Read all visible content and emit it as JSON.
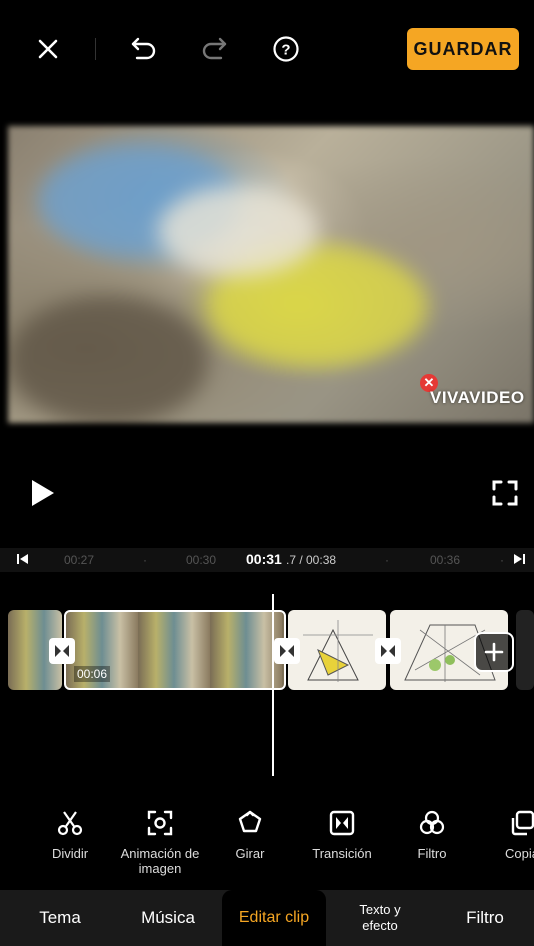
{
  "toolbar": {
    "save_label": "GUARDAR"
  },
  "preview": {
    "watermark_x": "✕",
    "watermark": "VIVAVIDEO"
  },
  "ruler": {
    "t1": "00:27",
    "t2": "00:30",
    "current": "00:31",
    "rest": ".7 / 00:38",
    "t3": "00:36"
  },
  "timeline": {
    "selected_clip_duration": "00:06"
  },
  "tools": [
    {
      "label": "Dividir",
      "icon": "scissors-icon"
    },
    {
      "label": "Animación de imagen",
      "icon": "focus-frame-icon"
    },
    {
      "label": "Girar",
      "icon": "rotate-icon"
    },
    {
      "label": "Transición",
      "icon": "transition-icon"
    },
    {
      "label": "Filtro",
      "icon": "filter-icon"
    },
    {
      "label": "Copia",
      "icon": "copy-icon"
    }
  ],
  "tabs": [
    {
      "label": "Tema"
    },
    {
      "label": "Música"
    },
    {
      "label": "Editar clip",
      "active": true
    },
    {
      "label": "Texto y efecto"
    },
    {
      "label": "Filtro"
    }
  ],
  "colors": {
    "accent": "#f5a623",
    "background": "#000000"
  }
}
